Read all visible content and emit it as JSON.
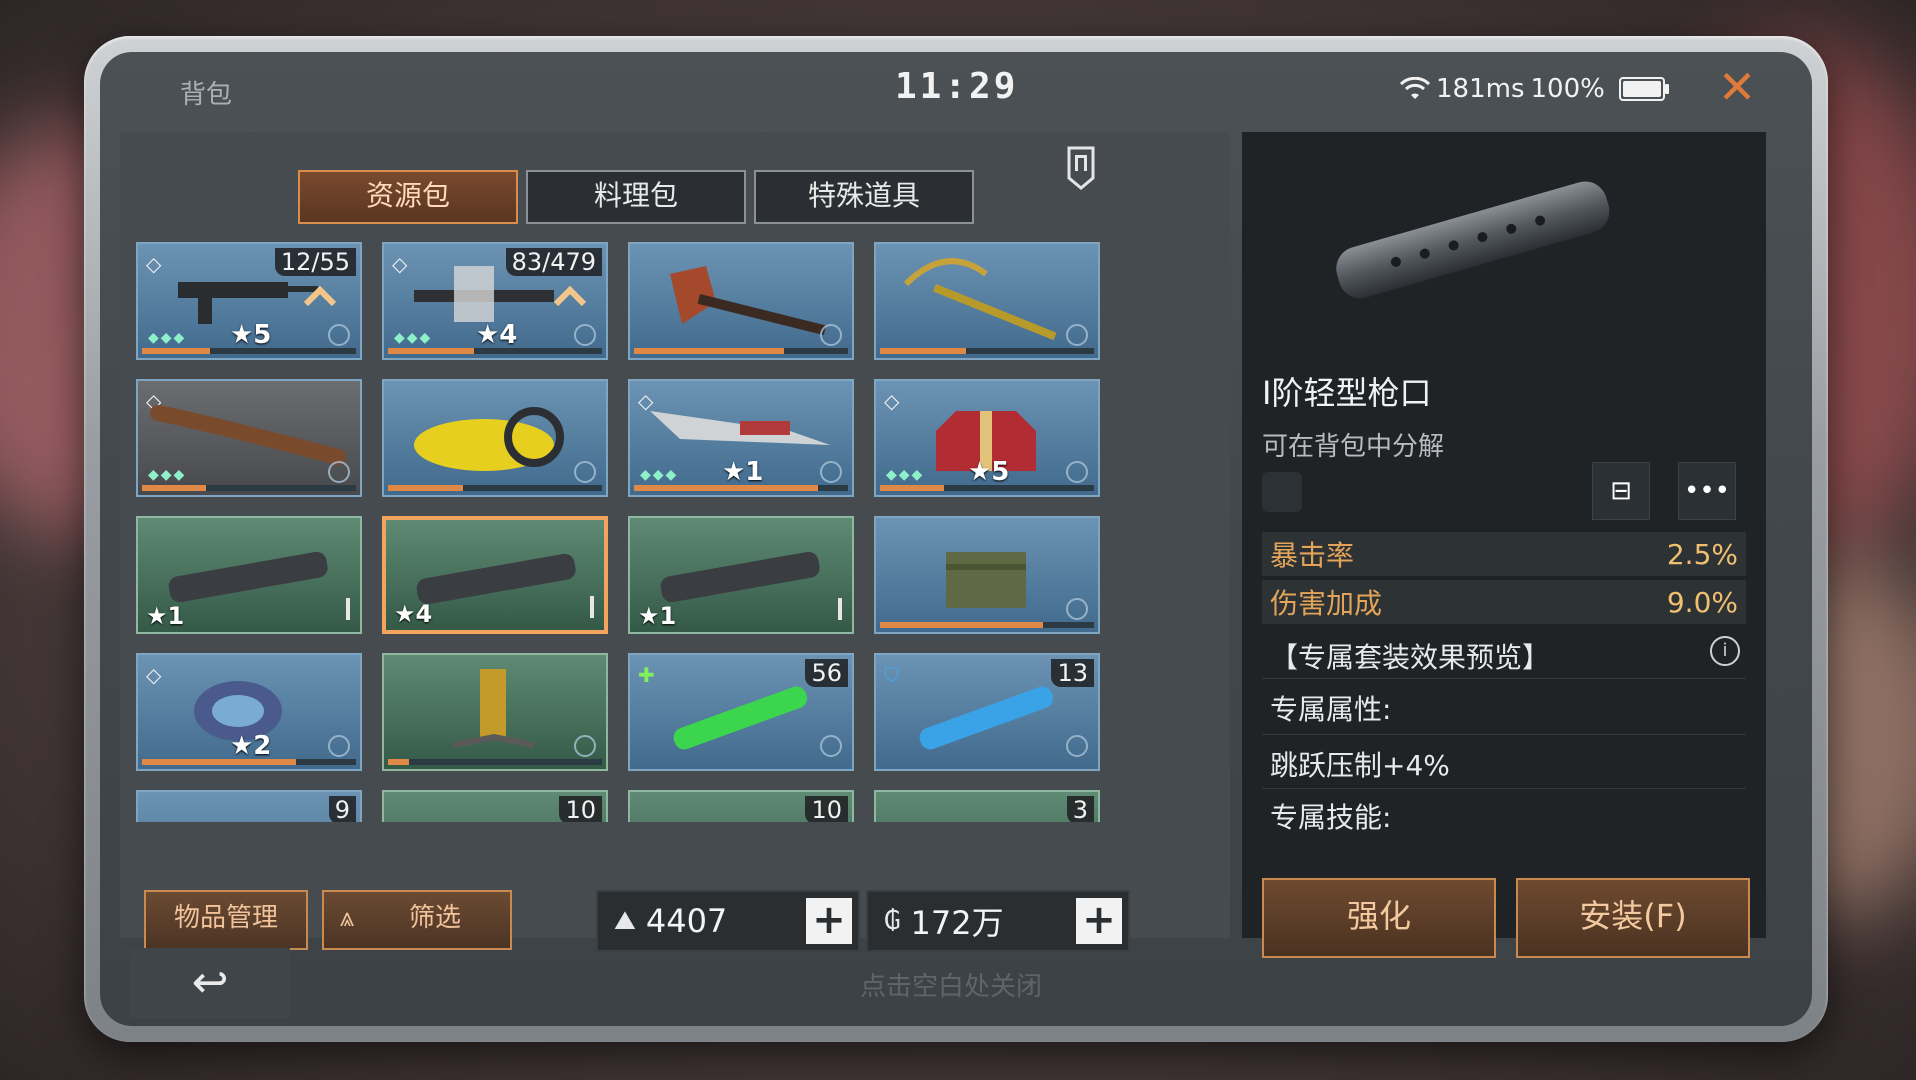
{
  "header": {
    "title": "背包",
    "clock": "11:29",
    "ping": "181ms",
    "battery": "100%"
  },
  "tabs": [
    "资源包",
    "料理包",
    "特殊道具"
  ],
  "grid": [
    {
      "qty": "12/55",
      "level": "5"
    },
    {
      "qty": "83/479",
      "level": "4"
    },
    {},
    {},
    {},
    {},
    {
      "level": "1"
    },
    {
      "level": "5"
    },
    {
      "level": "1"
    },
    {
      "level": "4"
    },
    {
      "level": "1"
    },
    {},
    {
      "level": "2"
    },
    {},
    {
      "qty": "56"
    },
    {
      "qty": "13"
    },
    {
      "qty": "9"
    },
    {
      "qty": "10"
    },
    {
      "qty": "10"
    },
    {
      "qty": "3"
    }
  ],
  "bottom": {
    "manage_label": "物品管理",
    "filter_label": "筛选",
    "currency1": "4407",
    "currency2": "172万"
  },
  "detail": {
    "name": "Ⅰ阶轻型枪口",
    "subtitle": "可在背包中分解",
    "stat1_label": "暴击率",
    "stat1_value": "2.5%",
    "stat2_label": "伤害加成",
    "stat2_value": "9.0%",
    "set_preview": "【专属套装效果预览】",
    "exclusive_attr": "专属属性:",
    "jump_suppress": "跳跃压制+4%",
    "exclusive_skill": "专属技能:",
    "enhance_label": "强化",
    "install_label": "安装(F)"
  },
  "footer": {
    "hint": "点击空白处关闭"
  },
  "colors": {
    "accent": "#e08846",
    "stat_label": "#e3a45a",
    "selected_border": "#f2a35c"
  }
}
